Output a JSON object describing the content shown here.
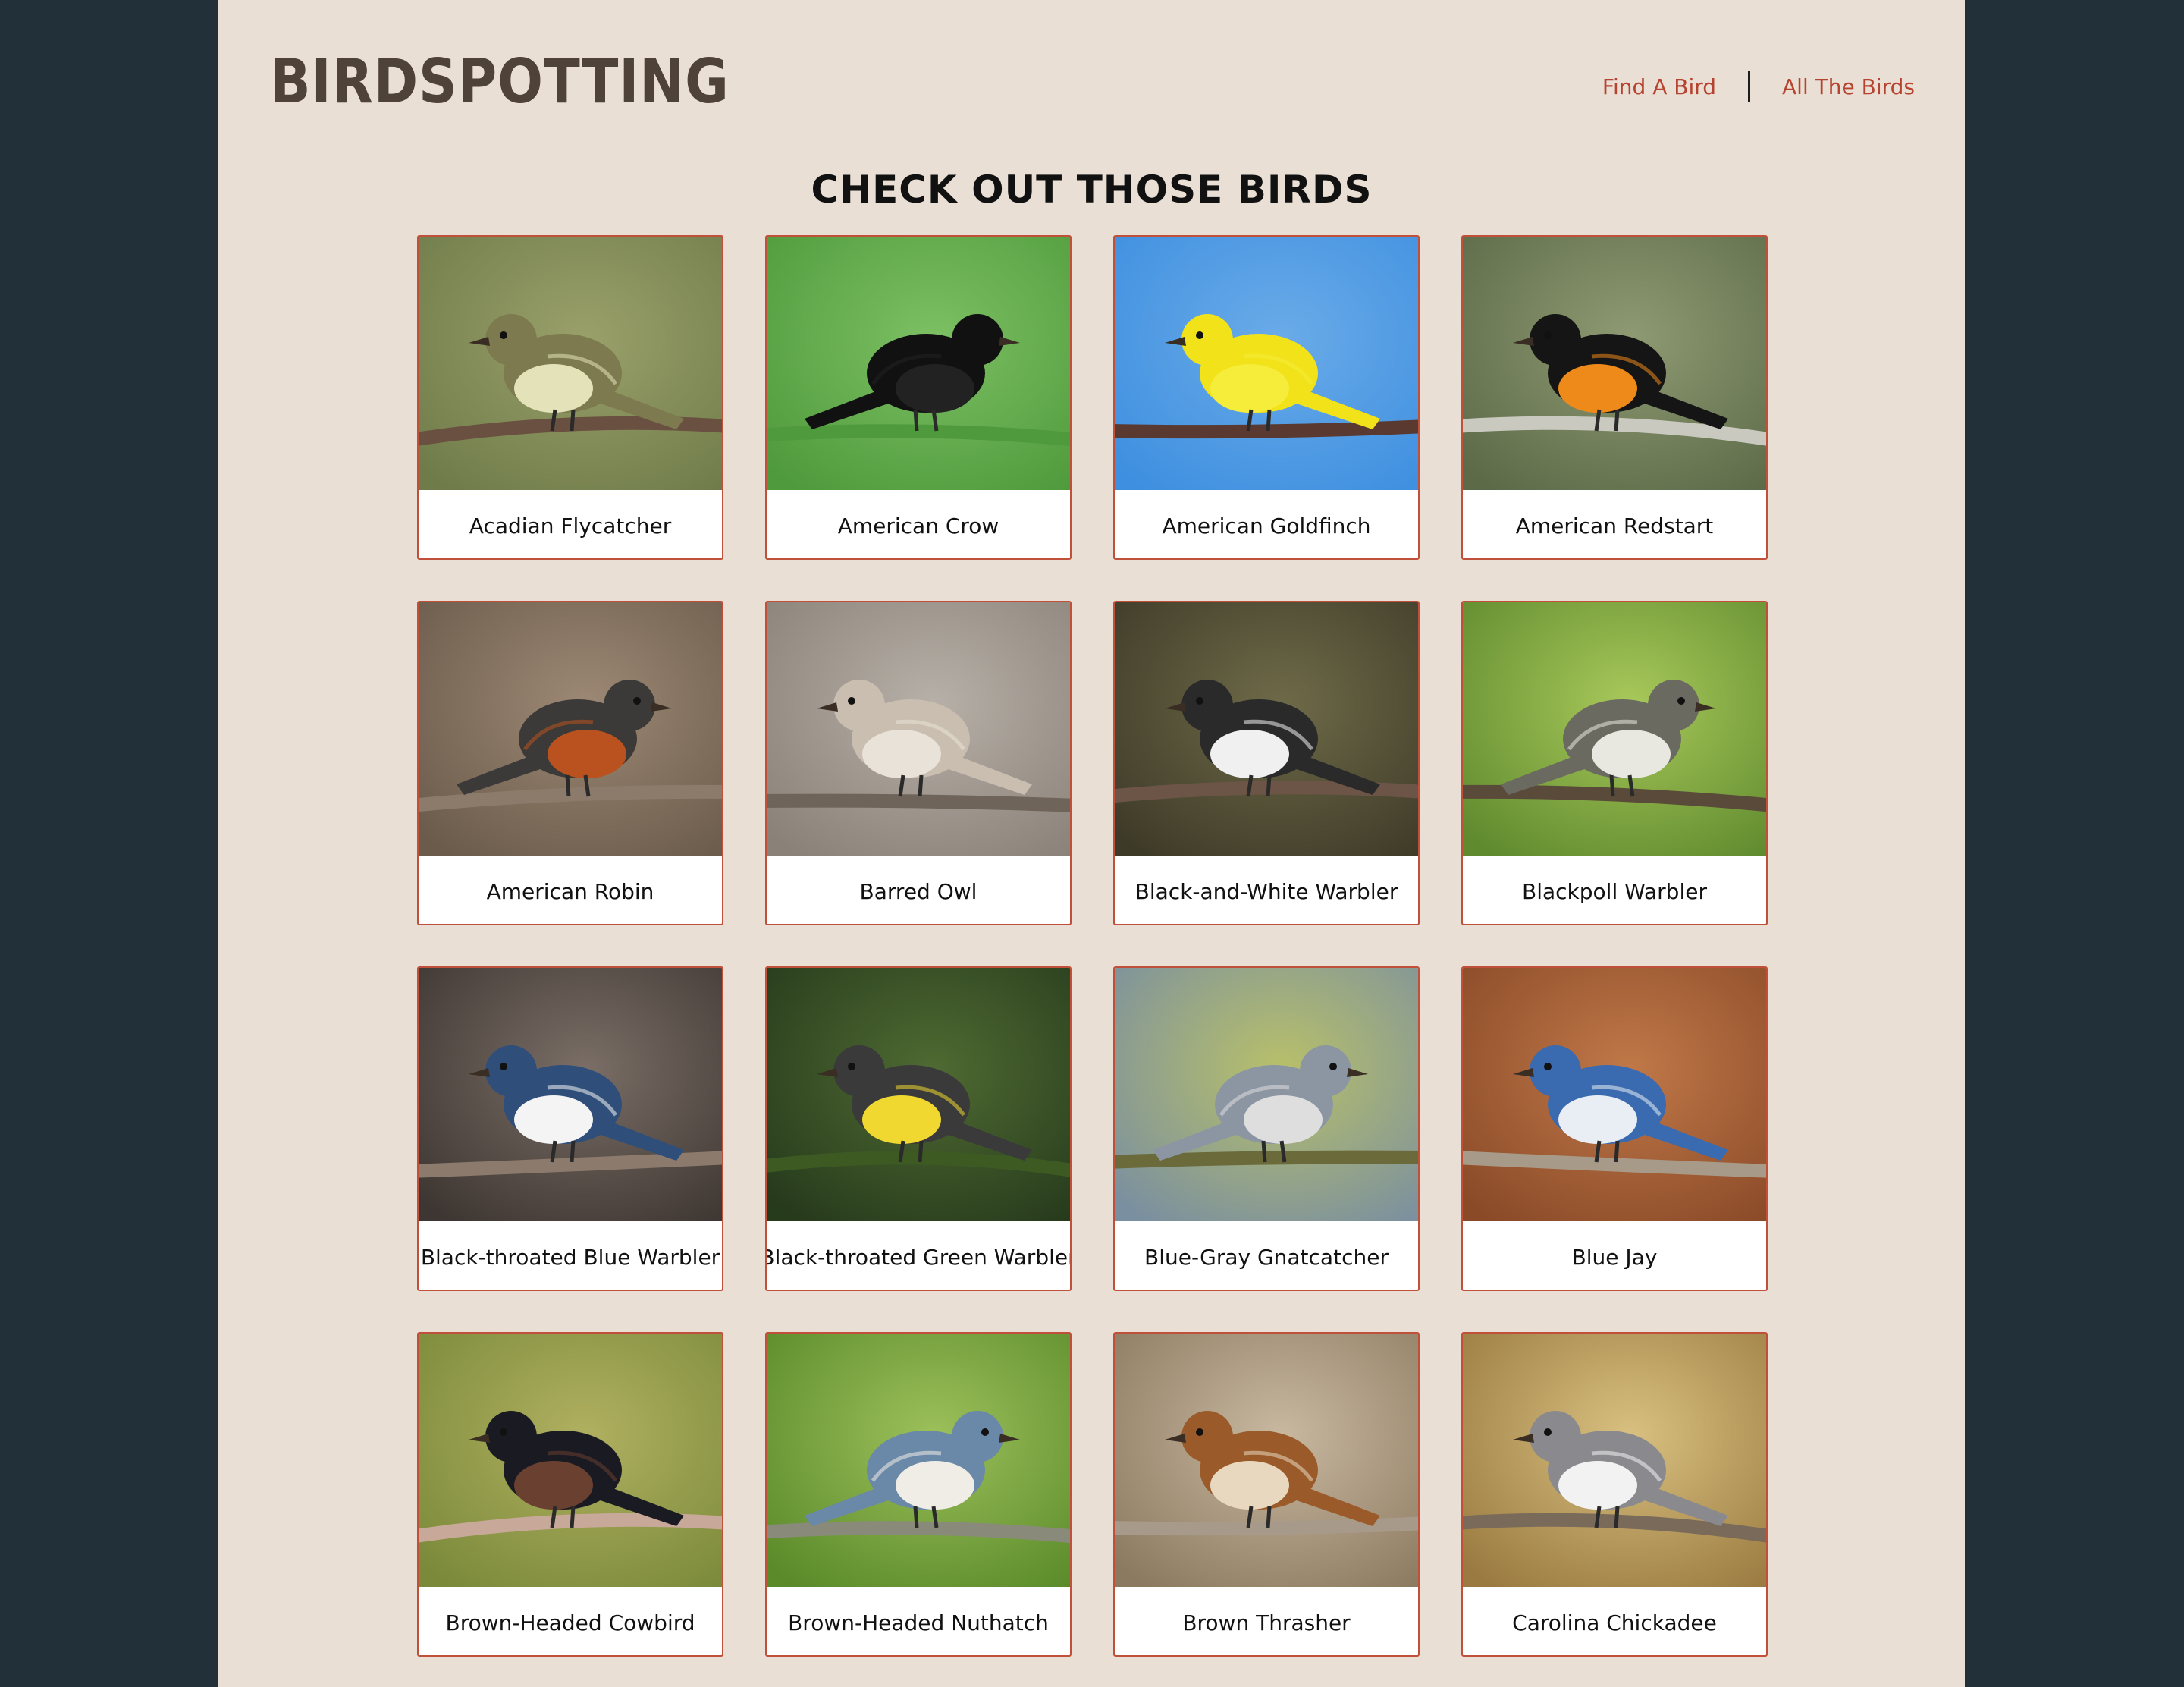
{
  "header": {
    "logo": "BIRDSPOTTING",
    "nav": [
      {
        "label": "Find A Bird"
      },
      {
        "label": "All The Birds"
      }
    ]
  },
  "main": {
    "title": "CHECK OUT THOSE BIRDS"
  },
  "birds": [
    {
      "name": "Acadian Flycatcher",
      "bg": "#6f7c4a",
      "bg2": "#9aa06a",
      "body": "#7c7a4e",
      "belly": "#e4e2b8",
      "perch": "#6a5040"
    },
    {
      "name": "American Crow",
      "bg": "#4f9a3c",
      "bg2": "#7cc063",
      "body": "#111111",
      "belly": "#222222",
      "perch": "#4f9a3c"
    },
    {
      "name": "American Goldfinch",
      "bg": "#3e8fe0",
      "bg2": "#6aabe8",
      "body": "#f2e21a",
      "belly": "#f6ec3a",
      "perch": "#5a3a30"
    },
    {
      "name": "American Redstart",
      "bg": "#5c6a48",
      "bg2": "#8e9a72",
      "body": "#151515",
      "belly": "#ee8a1a",
      "perch": "#c9c9c0"
    },
    {
      "name": "American Robin",
      "bg": "#6b5b4b",
      "bg2": "#9c8874",
      "body": "#3c3a38",
      "belly": "#b9521e",
      "perch": "#8c7a6a"
    },
    {
      "name": "Barred Owl",
      "bg": "#8a8178",
      "bg2": "#b7b0a8",
      "body": "#c9beb0",
      "belly": "#e9e2d8",
      "perch": "#6f6459"
    },
    {
      "name": "Black-and-White Warbler",
      "bg": "#3e3a28",
      "bg2": "#6e6a48",
      "body": "#2a2a2a",
      "belly": "#f0f0f0",
      "perch": "#6c5446"
    },
    {
      "name": "Blackpoll Warbler",
      "bg": "#5f8a2e",
      "bg2": "#a8c85a",
      "body": "#6a6a60",
      "belly": "#e8e8e0",
      "perch": "#5a4a3a"
    },
    {
      "name": "Black-throated Blue Warbler",
      "bg": "#3e3632",
      "bg2": "#7a6e66",
      "body": "#2f4f7a",
      "belly": "#f4f4f4",
      "perch": "#8c7a6c"
    },
    {
      "name": "Black-throated Green Warbler",
      "bg": "#263a1c",
      "bg2": "#4f6a32",
      "body": "#3a3a3a",
      "belly": "#f0d830",
      "perch": "#3d5a22"
    },
    {
      "name": "Blue-Gray Gnatcatcher",
      "bg": "#7a8fa0",
      "bg2": "#b8c06a",
      "body": "#8c96a2",
      "belly": "#dedede",
      "perch": "#6a6a3a"
    },
    {
      "name": "Blue Jay",
      "bg": "#8a4a28",
      "bg2": "#c07848",
      "body": "#3a6ab0",
      "belly": "#e8eef4",
      "perch": "#a89a88"
    },
    {
      "name": "Brown-Headed Cowbird",
      "bg": "#7a8a3a",
      "bg2": "#b0b060",
      "body": "#1a1a22",
      "belly": "#6a4030",
      "perch": "#c8a898"
    },
    {
      "name": "Brown-Headed Nuthatch",
      "bg": "#5a8a2a",
      "bg2": "#9cc05a",
      "body": "#6a88a8",
      "belly": "#f0ece6",
      "perch": "#8a8a7a"
    },
    {
      "name": "Brown Thrasher",
      "bg": "#8c7a60",
      "bg2": "#c8b8a0",
      "body": "#9a5a2a",
      "belly": "#e8d8c0",
      "perch": "#a89a8a"
    },
    {
      "name": "Carolina Chickadee",
      "bg": "#9a7a40",
      "bg2": "#d8c080",
      "body": "#8a8a8e",
      "belly": "#f2f2f2",
      "perch": "#7a6a5a"
    }
  ]
}
